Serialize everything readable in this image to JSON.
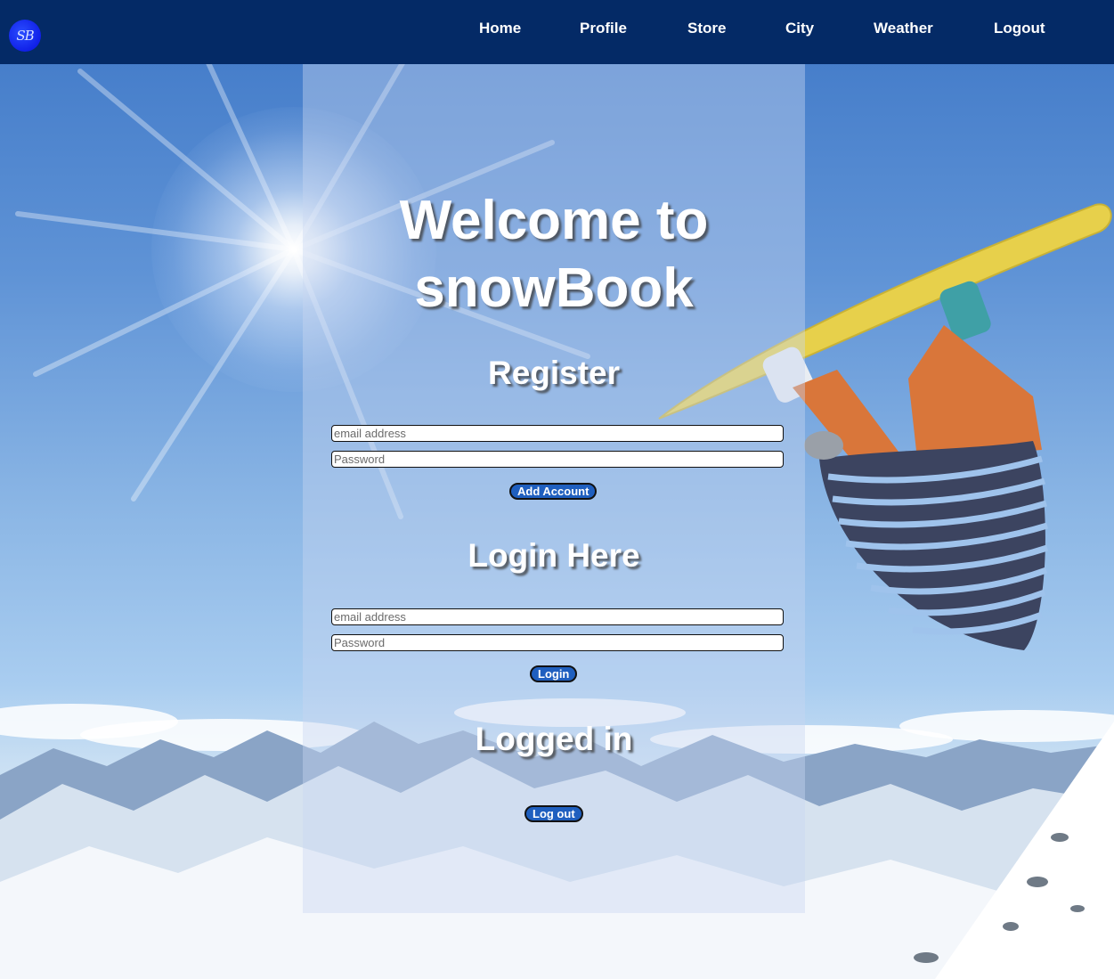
{
  "nav": {
    "logo_text": "SB",
    "links": [
      "Home",
      "Profile",
      "Store",
      "City",
      "Weather",
      "Logout"
    ]
  },
  "main": {
    "title_line1": "Welcome to",
    "title_line2": "snowBook",
    "register": {
      "heading": "Register",
      "email_placeholder": "email address",
      "password_placeholder": "Password",
      "button": "Add Account"
    },
    "login": {
      "heading": "Login Here",
      "email_placeholder": "email address",
      "password_placeholder": "Password",
      "button": "Login"
    },
    "status": {
      "heading": "Logged in",
      "button": "Log out"
    }
  },
  "colors": {
    "navbar": "#042a66",
    "button": "#1f5fbf",
    "logo": "#1020e8"
  },
  "icons": {
    "logo": "sb-logo-icon"
  }
}
